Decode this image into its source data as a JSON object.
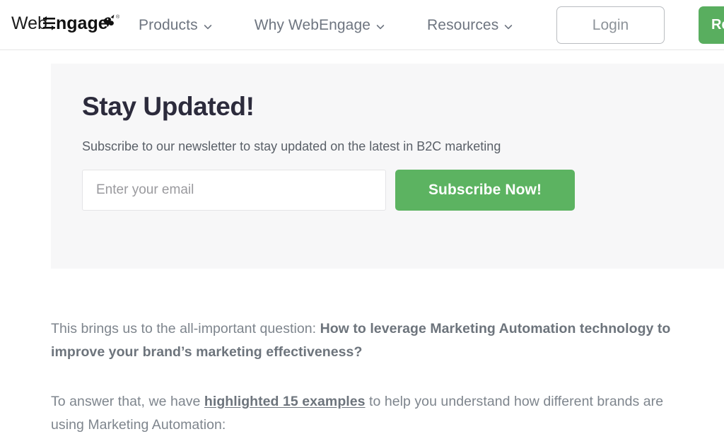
{
  "header": {
    "logo": {
      "text": "WebEngage",
      "icon": "webengage-bird-logo",
      "trademark": "®"
    },
    "nav": [
      {
        "label": "Products",
        "icon": "chevron-down-icon"
      },
      {
        "label": "Why WebEngage",
        "icon": "chevron-down-icon"
      },
      {
        "label": "Resources",
        "icon": "chevron-down-icon"
      }
    ],
    "login_label": "Login",
    "cta_label": "Request",
    "colors": {
      "cta_green": "#59ae5f",
      "border": "#e6e6e6",
      "nav_text": "#6e7580"
    }
  },
  "newsletter": {
    "title": "Stay Updated!",
    "subtitle": "Subscribe to our newsletter to stay updated on the latest in B2C marketing",
    "email_placeholder": "Enter your email",
    "email_value": "",
    "subscribe_label": "Subscribe Now!",
    "colors": {
      "panel_bg": "#f7f7f8",
      "button_green": "#5cb361",
      "title": "#2c2b3c"
    }
  },
  "article": {
    "paragraph1": {
      "lead": "This brings us to the all-important question: ",
      "bold": "How to leverage Marketing Automation technology to improve your brand’s marketing effectiveness?"
    },
    "paragraph2": {
      "lead": "To answer that, we have ",
      "link": "highlighted 15 examples",
      "tail": " to help you understand how different brands are using Marketing Automation:"
    },
    "colors": {
      "text": "#7e858d",
      "bold_text": "#6d747c"
    }
  }
}
